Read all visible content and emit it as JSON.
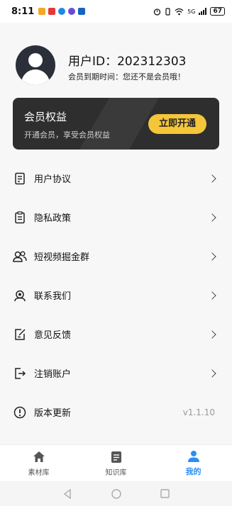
{
  "status_bar": {
    "time": "8:11",
    "battery": "67",
    "network": "5G"
  },
  "profile": {
    "user_id_label": "用户ID：202312303",
    "member_expire": "会员到期时间：您还不是会员哦！"
  },
  "member_card": {
    "title": "会员权益",
    "subtitle": "开通会员，享受会员权益",
    "button": "立即开通"
  },
  "menu": {
    "items": [
      {
        "label": "用户协议",
        "icon": "document-icon"
      },
      {
        "label": "隐私政策",
        "icon": "clipboard-icon"
      },
      {
        "label": "短视频掘金群",
        "icon": "group-icon"
      },
      {
        "label": "联系我们",
        "icon": "contact-icon"
      },
      {
        "label": "意见反馈",
        "icon": "feedback-icon"
      },
      {
        "label": "注销账户",
        "icon": "logout-icon"
      },
      {
        "label": "版本更新",
        "icon": "info-icon"
      }
    ],
    "version": "v1.1.10"
  },
  "bottom_nav": {
    "tabs": [
      {
        "label": "素材库",
        "icon": "home-icon"
      },
      {
        "label": "知识库",
        "icon": "book-icon"
      },
      {
        "label": "我的",
        "icon": "user-icon"
      }
    ],
    "active_color": "#2a8ef5"
  },
  "colors": {
    "card_bg": "#2e2e2e",
    "button_bg": "#f5c53a",
    "accent": "#2a8ef5"
  }
}
